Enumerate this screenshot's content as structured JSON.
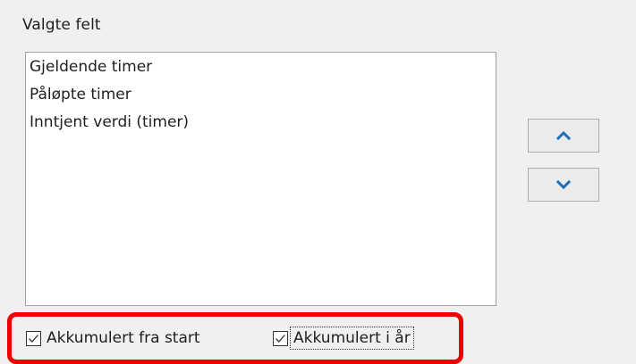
{
  "group": {
    "label": "Valgte felt"
  },
  "listbox": {
    "items": [
      {
        "label": "Gjeldende timer"
      },
      {
        "label": "Påløpte timer"
      },
      {
        "label": "Inntjent verdi (timer)"
      }
    ]
  },
  "buttons": {
    "move_up_icon": "chevron-up-icon",
    "move_down_icon": "chevron-down-icon",
    "icon_color": "#1e6fb8"
  },
  "options": {
    "accumulated_from_start": {
      "label": "Akkumulert fra start",
      "checked": true
    },
    "accumulated_this_year": {
      "label": "Akkumulert i år",
      "checked": true,
      "focused": true
    }
  },
  "annotation": {
    "highlight_color": "#ee0000"
  }
}
